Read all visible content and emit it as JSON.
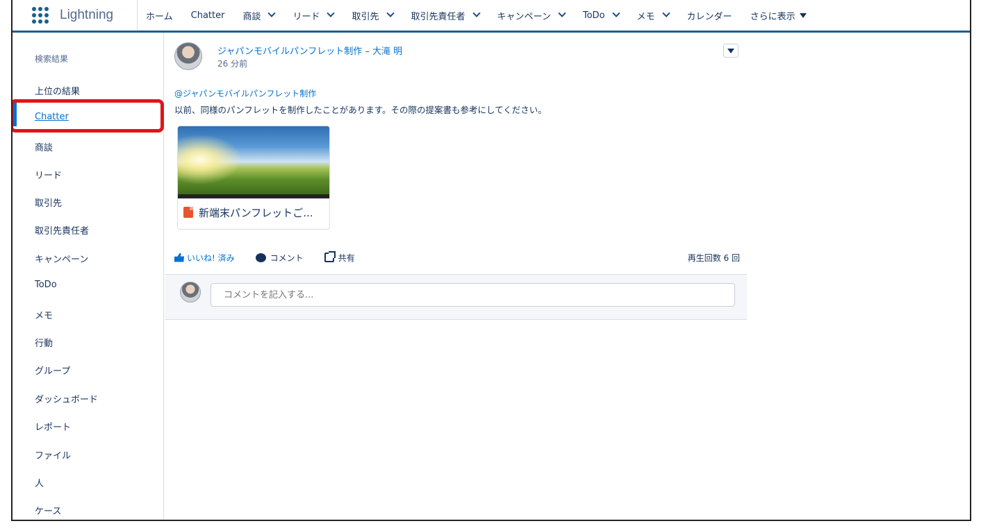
{
  "app": {
    "name": "Lightning"
  },
  "nav": {
    "items": [
      {
        "label": "ホーム",
        "dropdown": false
      },
      {
        "label": "Chatter",
        "dropdown": false
      },
      {
        "label": "商談",
        "dropdown": true
      },
      {
        "label": "リード",
        "dropdown": true
      },
      {
        "label": "取引先",
        "dropdown": true
      },
      {
        "label": "取引先責任者",
        "dropdown": true
      },
      {
        "label": "キャンペーン",
        "dropdown": true
      },
      {
        "label": "ToDo",
        "dropdown": true
      },
      {
        "label": "メモ",
        "dropdown": true
      },
      {
        "label": "カレンダー",
        "dropdown": false
      }
    ],
    "more_label": "さらに表示"
  },
  "sidebar": {
    "header": "検索結果",
    "items": [
      "上位の結果",
      "Chatter",
      "商談",
      "リード",
      "取引先",
      "取引先責任者",
      "キャンペーン",
      "ToDo",
      "メモ",
      "行動",
      "グループ",
      "ダッシュボード",
      "レポート",
      "ファイル",
      "人",
      "ケース"
    ],
    "active_item": "Chatter"
  },
  "post": {
    "author": "ジャパンモバイルパンフレット制作 – 大滝 明",
    "time": "26 分前",
    "mention": "@ジャパンモバイルパンフレット制作",
    "body": "以前、同様のパンフレットを制作したことがあります。その際の提案書も参考にしてください。",
    "attachment": {
      "name": "新端末パンフレットご...",
      "type": "pdf"
    },
    "actions": {
      "like": "いいね! 済み",
      "comment": "コメント",
      "share": "共有"
    },
    "view_count": "再生回数 6 回"
  },
  "comment": {
    "placeholder": "コメントを記入する..."
  },
  "colors": {
    "accent": "#0070d2",
    "nav_border": "#1b5f8c",
    "highlight": "#e0141b",
    "text": "#16325c"
  }
}
